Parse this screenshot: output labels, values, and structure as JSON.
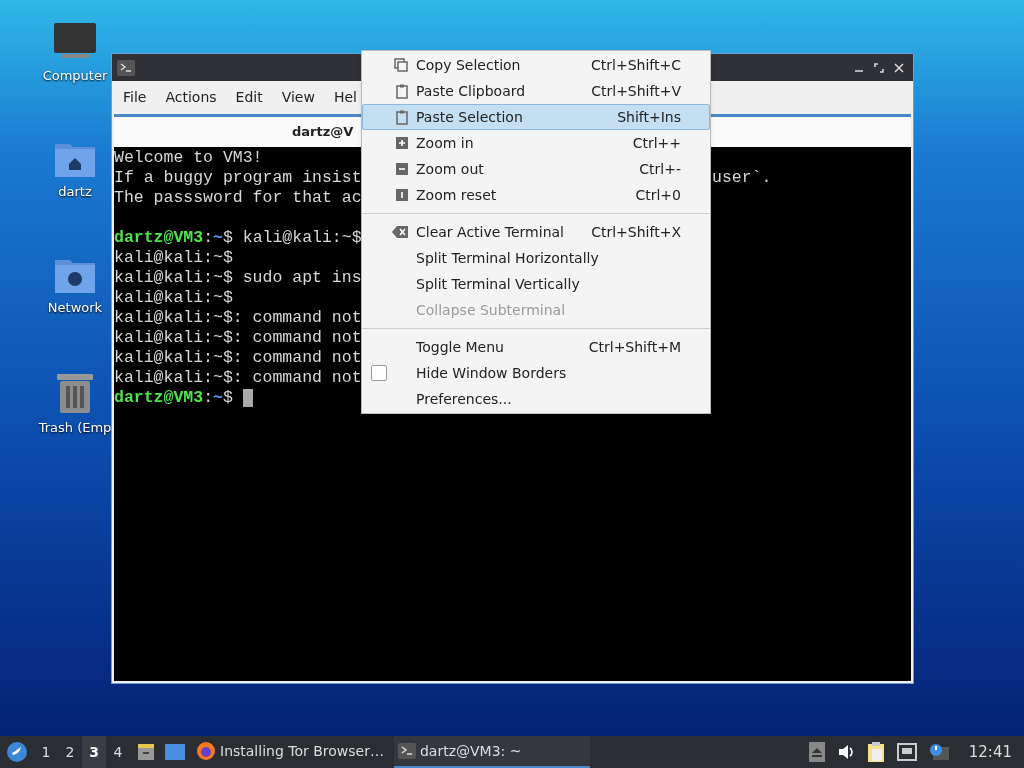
{
  "desktop_icons": [
    {
      "label": "Computer",
      "kind": "computer"
    },
    {
      "label": "dartz",
      "kind": "home"
    },
    {
      "label": "Network",
      "kind": "network"
    },
    {
      "label": "Trash (Emp",
      "kind": "trash"
    }
  ],
  "window": {
    "menubar": [
      "File",
      "Actions",
      "Edit",
      "View",
      "Hel"
    ],
    "tab_title": "dartz@V",
    "terminal_blocks": [
      [
        {
          "parts": [
            {
              "kind": "plain",
              "text": "Welcome to VM3!"
            }
          ]
        },
        {
          "parts": [
            {
              "kind": "plain",
              "text": "If a buggy program insist"
            }
          ],
          "tail": "user`."
        },
        {
          "parts": [
            {
              "kind": "plain",
              "text": "The passsword for that ac"
            }
          ]
        }
      ],
      [
        {
          "parts": [
            {
              "kind": "user",
              "text": "dartz@VM3"
            },
            {
              "kind": "plain",
              "text": ":"
            },
            {
              "kind": "path",
              "text": "~"
            },
            {
              "kind": "plain",
              "text": "$ kali@kali:~$"
            }
          ]
        },
        {
          "parts": [
            {
              "kind": "plain",
              "text": "kali@kali:~$"
            }
          ]
        },
        {
          "parts": [
            {
              "kind": "plain",
              "text": "kali@kali:~$ sudo apt ins"
            }
          ]
        },
        {
          "parts": [
            {
              "kind": "plain",
              "text": "kali@kali:~$"
            }
          ]
        },
        {
          "parts": [
            {
              "kind": "plain",
              "text": "kali@kali:~$: command not"
            }
          ]
        },
        {
          "parts": [
            {
              "kind": "plain",
              "text": "kali@kali:~$: command not"
            }
          ]
        },
        {
          "parts": [
            {
              "kind": "plain",
              "text": "kali@kali:~$: command not"
            }
          ]
        },
        {
          "parts": [
            {
              "kind": "plain",
              "text": "kali@kali:~$: command not"
            }
          ]
        },
        {
          "parts": [
            {
              "kind": "user",
              "text": "dartz@VM3"
            },
            {
              "kind": "plain",
              "text": ":"
            },
            {
              "kind": "path",
              "text": "~"
            },
            {
              "kind": "plain",
              "text": "$ "
            }
          ],
          "cursor": true
        }
      ]
    ]
  },
  "context_menu": {
    "groups": [
      [
        {
          "label": "Copy Selection",
          "shortcut": "Ctrl+Shift+C",
          "kind": "copy",
          "selected": false,
          "disabled": false
        },
        {
          "label": "Paste Clipboard",
          "shortcut": "Ctrl+Shift+V",
          "kind": "paste",
          "selected": false,
          "disabled": false
        },
        {
          "label": "Paste Selection",
          "shortcut": "Shift+Ins",
          "kind": "paste",
          "selected": true,
          "disabled": false
        },
        {
          "label": "Zoom in",
          "shortcut": "Ctrl++",
          "kind": "zoomin",
          "selected": false,
          "disabled": false
        },
        {
          "label": "Zoom out",
          "shortcut": "Ctrl+-",
          "kind": "zoomout",
          "selected": false,
          "disabled": false
        },
        {
          "label": "Zoom reset",
          "shortcut": "Ctrl+0",
          "kind": "zoomreset",
          "selected": false,
          "disabled": false
        }
      ],
      [
        {
          "label": "Clear Active Terminal",
          "shortcut": "Ctrl+Shift+X",
          "kind": "clear",
          "selected": false,
          "disabled": false
        },
        {
          "label": "Split Terminal Horizontally",
          "selected": false,
          "disabled": false
        },
        {
          "label": "Split Terminal Vertically",
          "selected": false,
          "disabled": false
        },
        {
          "label": "Collapse Subterminal",
          "selected": false,
          "disabled": true
        }
      ],
      [
        {
          "label": "Toggle Menu",
          "shortcut": "Ctrl+Shift+M",
          "selected": false,
          "disabled": false
        },
        {
          "label": "Hide Window Borders",
          "kind": "checkbox",
          "checked": false,
          "selected": false,
          "disabled": false
        },
        {
          "label": "Preferences...",
          "selected": false,
          "disabled": false
        }
      ]
    ]
  },
  "taskbar": {
    "workspaces": [
      {
        "label": "1",
        "selected": false
      },
      {
        "label": "2",
        "selected": false
      },
      {
        "label": "3",
        "selected": true
      },
      {
        "label": "4",
        "selected": false
      }
    ],
    "tasks": [
      {
        "label": "Installing Tor Browser…",
        "kind": "browser",
        "selected": false
      },
      {
        "label": "dartz@VM3: ~",
        "kind": "terminal",
        "selected": true
      }
    ],
    "clock": "12:41"
  }
}
